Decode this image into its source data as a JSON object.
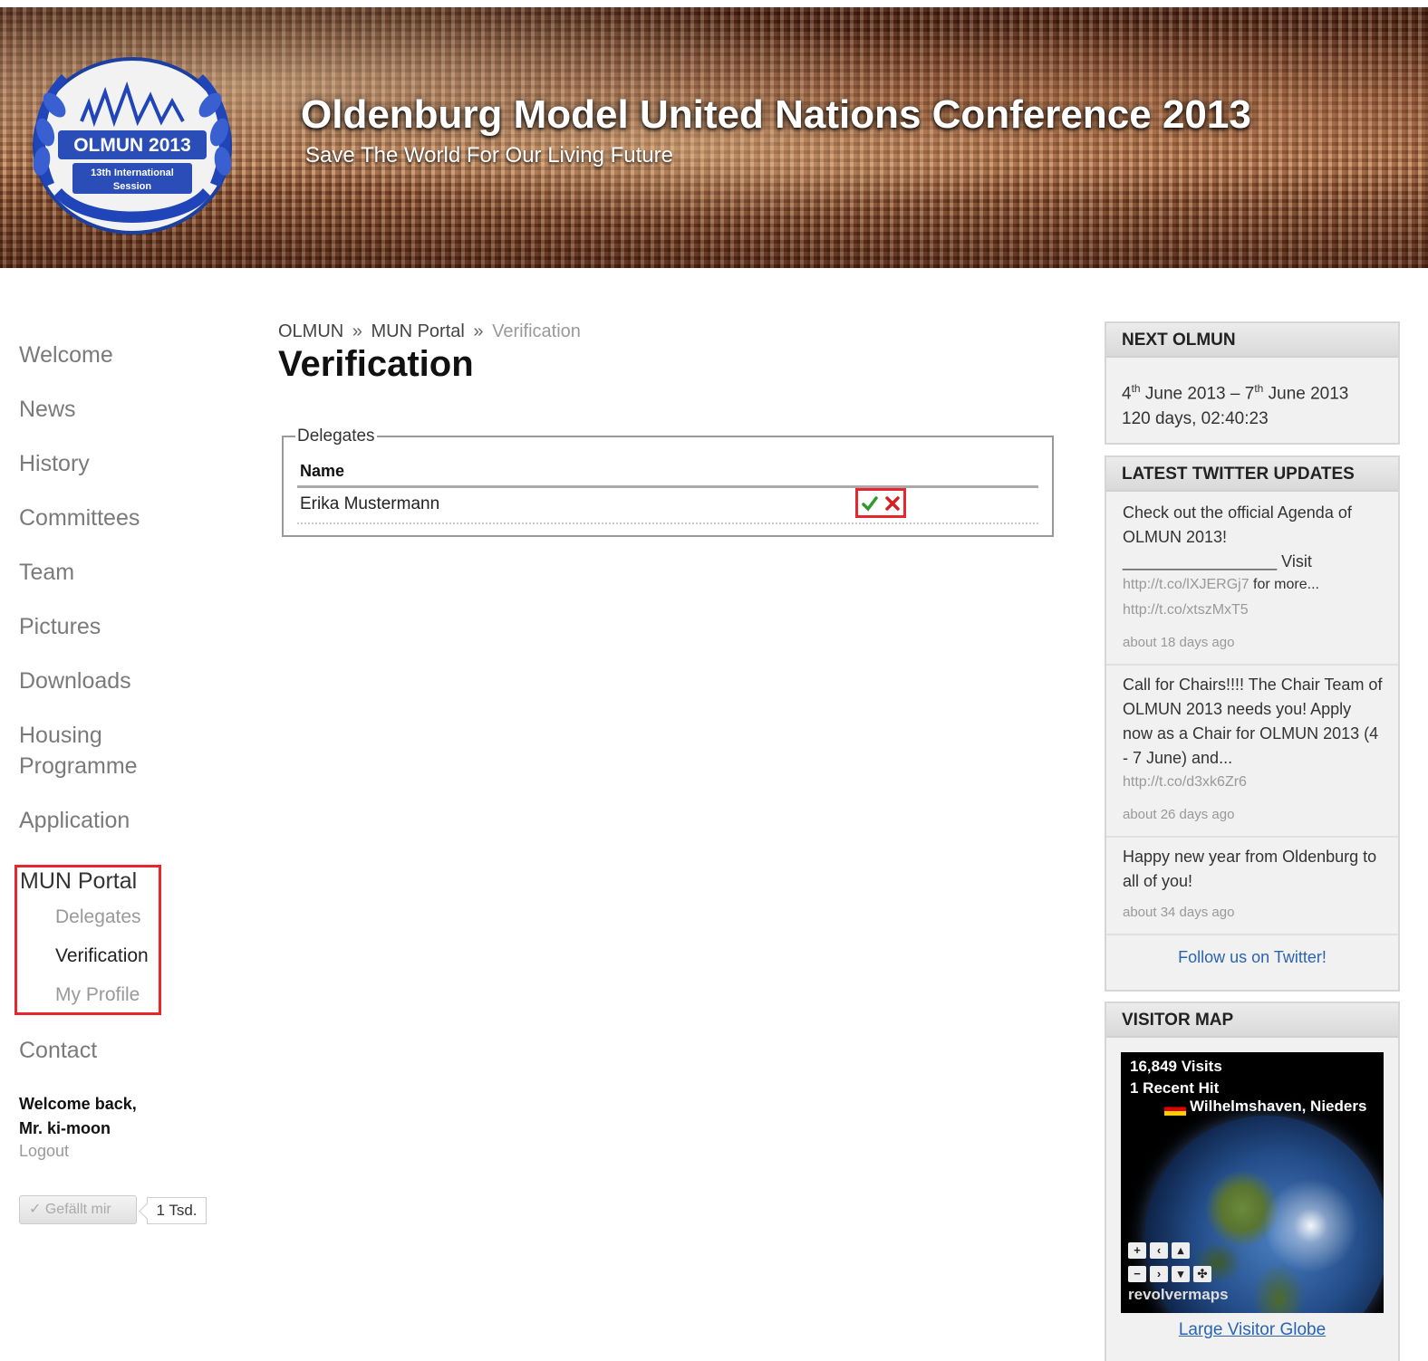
{
  "header": {
    "logo_line1": "OLMUN 2013",
    "logo_line2": "13th International",
    "logo_line3": "Session",
    "title": "Oldenburg Model United Nations Conference 2013",
    "subtitle": "Save The World For Our Living Future"
  },
  "nav": {
    "items": [
      "Welcome",
      "News",
      "History",
      "Committees",
      "Team",
      "Pictures",
      "Downloads",
      "Housing Programme",
      "Application"
    ],
    "portal_title": "MUN Portal",
    "portal_items": [
      "Delegates",
      "Verification",
      "My Profile"
    ],
    "contact": "Contact",
    "welcome_line1": "Welcome back,",
    "welcome_line2": "Mr. ki-moon",
    "logout": "Logout",
    "like_label": "✓ Gefällt mir",
    "like_count": "1 Tsd."
  },
  "main": {
    "breadcrumb": [
      "OLMUN",
      "MUN Portal",
      "Verification"
    ],
    "breadcrumb_sep": "»",
    "title": "Verification",
    "fieldset_legend": "Delegates",
    "column_name": "Name",
    "rows": [
      {
        "name": "Erika Mustermann"
      }
    ]
  },
  "sidebar": {
    "next": {
      "title": "NEXT OLMUN",
      "start_day": "4",
      "start_sup": "th",
      "start_rest": " June 2013",
      "dash": " – ",
      "end_day": "7",
      "end_sup": "th",
      "end_rest": " June 2013",
      "countdown": "120 days, 02:40:23"
    },
    "twitter": {
      "title": "LATEST TWITTER UPDATES",
      "tweets": [
        {
          "text": "Check out the official Agenda of OLMUN 2013!",
          "line3": "_________________ Visit",
          "link1": "http://t.co/lXJERGj7",
          "link1_suffix": " for more...",
          "link2": "http://t.co/xtszMxT5",
          "time": "about 18 days ago"
        },
        {
          "text": "Call for Chairs!!!! The Chair Team of OLMUN 2013 needs you! Apply now as a Chair for OLMUN 2013 (4 - 7 June) and...",
          "link1": "http://t.co/d3xk6Zr6",
          "time": "about 26 days ago"
        },
        {
          "text": "Happy new year from Oldenburg to all of you!",
          "time": "about 34 days ago"
        }
      ],
      "follow": "Follow us on Twitter!"
    },
    "visitor": {
      "title": "VISITOR MAP",
      "visits": "16,849 Visits",
      "recent": "1 Recent Hit",
      "location": "Wilhelmshaven, Nieders",
      "brand": "revolvermaps",
      "large_link": "Large Visitor Globe"
    }
  }
}
